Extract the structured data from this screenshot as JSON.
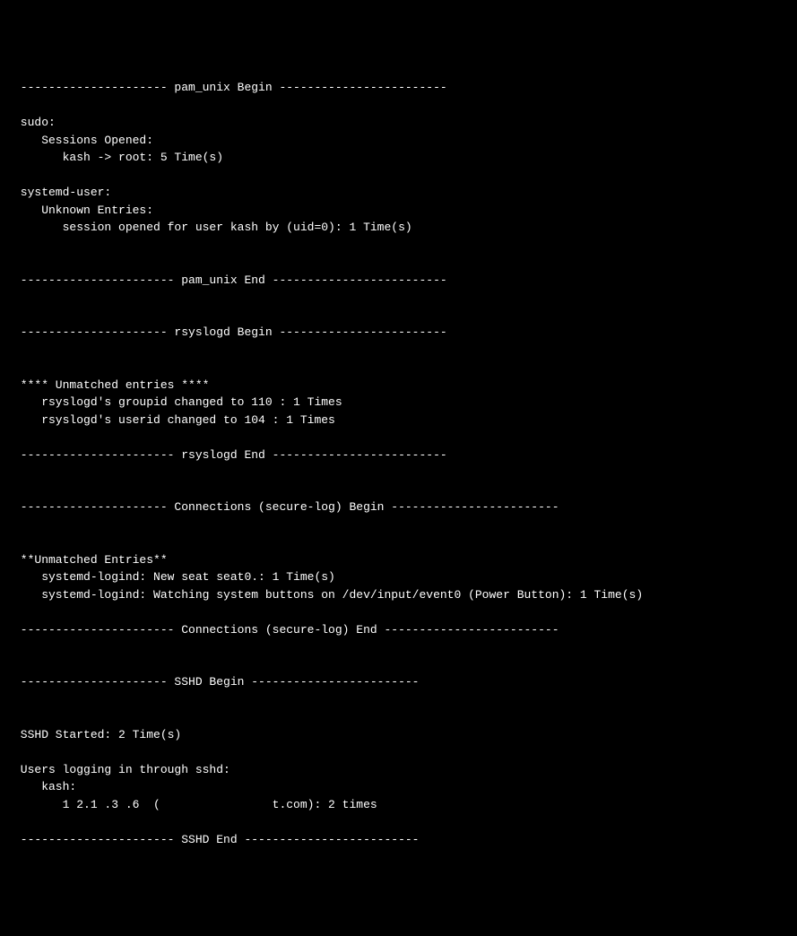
{
  "lines": [
    " --------------------- pam_unix Begin ------------------------ ",
    " ",
    " sudo:",
    "    Sessions Opened:",
    "       kash -> root: 5 Time(s)",
    " ",
    " systemd-user:",
    "    Unknown Entries:",
    "       session opened for user kash by (uid=0): 1 Time(s)",
    " ",
    " ",
    " ---------------------- pam_unix End ------------------------- ",
    "",
    " ",
    " --------------------- rsyslogd Begin ------------------------ ",
    "",
    " ",
    " **** Unmatched entries ****",
    "    rsyslogd's groupid changed to 110 : 1 Times",
    "    rsyslogd's userid changed to 104 : 1 Times",
    " ",
    " ---------------------- rsyslogd End ------------------------- ",
    "",
    " ",
    " --------------------- Connections (secure-log) Begin ------------------------ ",
    "",
    " ",
    " **Unmatched Entries**",
    "    systemd-logind: New seat seat0.: 1 Time(s)",
    "    systemd-logind: Watching system buttons on /dev/input/event0 (Power Button): 1 Time(s)",
    " ",
    " ---------------------- Connections (secure-log) End ------------------------- ",
    "",
    " ",
    " --------------------- SSHD Begin ------------------------ ",
    "",
    " ",
    " SSHD Started: 2 Time(s)",
    " ",
    " Users logging in through sshd:",
    "    kash:",
    "       1 2.1 .3 .6  (                t.com): 2 times",
    " ",
    " ---------------------- SSHD End ------------------------- "
  ]
}
